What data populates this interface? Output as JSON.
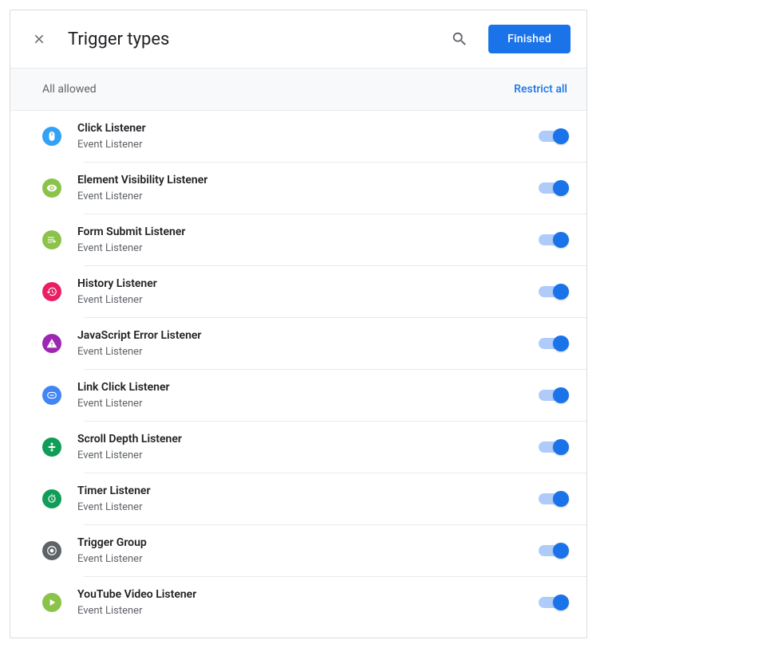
{
  "header": {
    "title": "Trigger types",
    "finished_label": "Finished"
  },
  "subheader": {
    "status": "All allowed",
    "restrict_label": "Restrict all"
  },
  "common": {
    "subtitle": "Event Listener"
  },
  "items": [
    {
      "title": "Click Listener",
      "icon": "mouse",
      "color": "#33a1f5"
    },
    {
      "title": "Element Visibility Listener",
      "icon": "eye",
      "color": "#8bc34a"
    },
    {
      "title": "Form Submit Listener",
      "icon": "form",
      "color": "#8bc34a"
    },
    {
      "title": "History Listener",
      "icon": "history",
      "color": "#e91e63"
    },
    {
      "title": "JavaScript Error Listener",
      "icon": "warning",
      "color": "#9c27b0"
    },
    {
      "title": "Link Click Listener",
      "icon": "link",
      "color": "#4285f4"
    },
    {
      "title": "Scroll Depth Listener",
      "icon": "scroll",
      "color": "#0f9d58"
    },
    {
      "title": "Timer Listener",
      "icon": "timer",
      "color": "#0f9d58"
    },
    {
      "title": "Trigger Group",
      "icon": "group",
      "color": "#5f6368"
    },
    {
      "title": "YouTube Video Listener",
      "icon": "play",
      "color": "#8bc34a"
    }
  ]
}
